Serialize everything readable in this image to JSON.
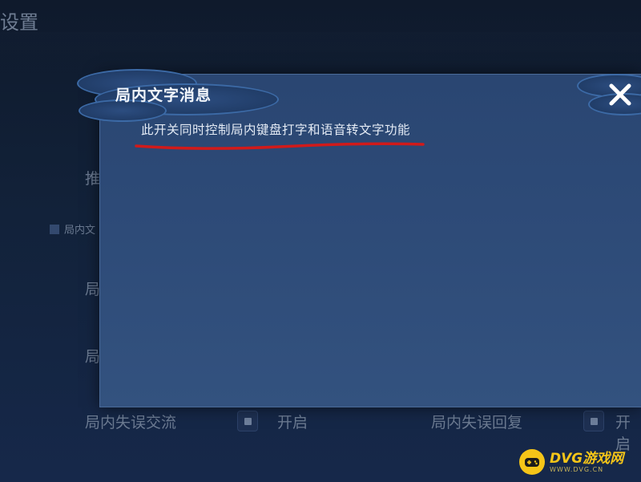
{
  "background": {
    "page_title": "设置",
    "section_label": "局内文",
    "rows_left": [
      "推",
      "局",
      "局"
    ],
    "bottom_left_label": "局内失误交流",
    "bottom_left_value": "开启",
    "bottom_right_label": "局内失误回复",
    "bottom_right_value": "开启"
  },
  "dialog": {
    "title": "局内文字消息",
    "message": "此开关同时控制局内键盘打字和语音转文字功能",
    "close_icon": "close-icon",
    "annotation_color": "#d11a1a"
  },
  "watermark": {
    "name": "DVG游戏网",
    "url": "WWW.DVG.CN"
  }
}
